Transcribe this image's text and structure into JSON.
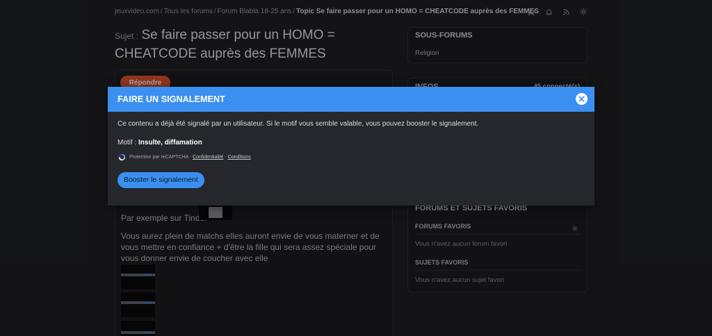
{
  "breadcrumb": {
    "items": [
      "jeuxvideo.com",
      "Tous les forums",
      "Forum Blabla 18-25 ans"
    ],
    "current": "Topic Se faire passer pour un HOMO = CHEATCODE auprès des FEMMES",
    "separator": "/"
  },
  "top_icons": [
    "star-icon",
    "bell-icon",
    "rss-icon",
    "gear-icon"
  ],
  "subject": {
    "label": "Sujet :",
    "title": "Se faire passer pour un HOMO = CHEATCODE auprès des FEMMES"
  },
  "post": {
    "reply_label": "Répondre",
    "line1": "Par exemple sur Tinder",
    "paragraph": "Vous aurez plein de matchs elles auront envie de vous materner et de vous mettre en confiance + d'être la fille qui sera assez spéciale pour vous donner envie de coucher avec elle"
  },
  "sidebar": {
    "sous_forums": {
      "title": "SOUS-FORUMS",
      "items": [
        "Religion"
      ]
    },
    "infos": {
      "title": "INFOS",
      "connected": "45 connecté(s)"
    },
    "favoris": {
      "title": "FORUMS ET SUJETS FAVORIS",
      "forums_title": "FORUMS FAVORIS",
      "forums_empty": "Vous n'avez aucun forum favori",
      "sujets_title": "SUJETS FAVORIS",
      "sujets_empty": "Vous n'avez aucun sujet favori"
    }
  },
  "modal": {
    "title": "FAIRE UN SIGNALEMENT",
    "message": "Ce contenu a déjà été signalé par un utilisateur. Si le motif vous semble valable, vous pouvez booster le signalement.",
    "motif_label": "Motif :",
    "motif_value": "Insulte, diffamation",
    "captcha_text": "Protection par reCAPTCHA -",
    "captcha_privacy": "Confidentialité",
    "captcha_sep": "-",
    "captcha_terms": "Conditions",
    "boost_label": "Booster le signalement"
  },
  "colors": {
    "accent": "#3b8ff0",
    "reply": "#e0512e",
    "background": "#1f2023",
    "modal": "#25272c"
  }
}
